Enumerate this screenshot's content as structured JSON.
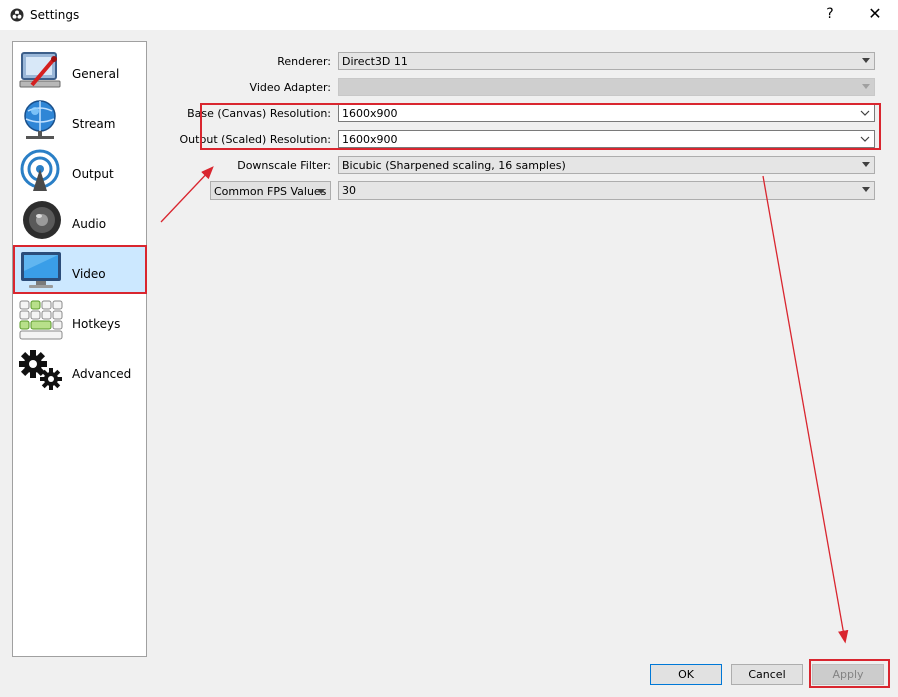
{
  "window": {
    "title": "Settings",
    "help_glyph": "?",
    "close_glyph": "✕"
  },
  "sidebar": {
    "items": [
      {
        "label": "General",
        "icon": "general-icon"
      },
      {
        "label": "Stream",
        "icon": "stream-icon"
      },
      {
        "label": "Output",
        "icon": "output-icon"
      },
      {
        "label": "Audio",
        "icon": "audio-icon"
      },
      {
        "label": "Video",
        "icon": "video-icon",
        "selected": true
      },
      {
        "label": "Hotkeys",
        "icon": "hotkeys-icon"
      },
      {
        "label": "Advanced",
        "icon": "advanced-icon"
      }
    ]
  },
  "video": {
    "renderer": {
      "label": "Renderer:",
      "value": "Direct3D 11"
    },
    "adapter": {
      "label": "Video Adapter:",
      "value": ""
    },
    "base_resolution": {
      "label": "Base (Canvas) Resolution:",
      "value": "1600x900"
    },
    "output_resolution": {
      "label": "Output (Scaled) Resolution:",
      "value": "1600x900"
    },
    "downscale_filter": {
      "label": "Downscale Filter:",
      "value": "Bicubic (Sharpened scaling, 16 samples)"
    },
    "fps_type": {
      "value": "Common FPS Values"
    },
    "fps": {
      "value": "30"
    }
  },
  "buttons": {
    "ok": "OK",
    "cancel": "Cancel",
    "apply": "Apply"
  },
  "colors": {
    "accent": "#0078d7",
    "annotation": "#d9262f",
    "selection": "#cce8ff"
  }
}
